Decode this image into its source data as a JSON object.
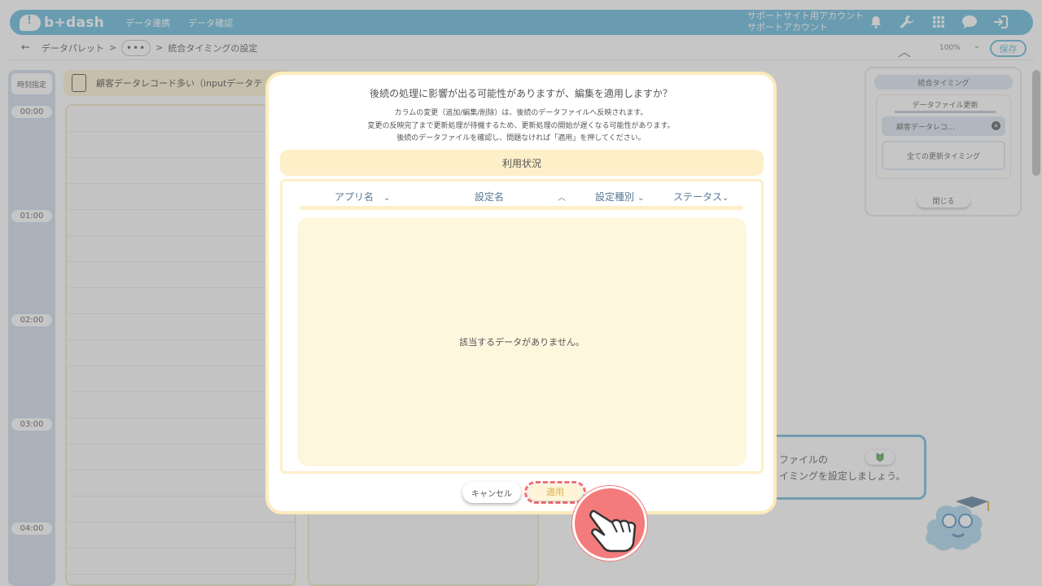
{
  "app": {
    "brand": "b+dash"
  },
  "topnav": {
    "links": [
      "データ連携",
      "データ確認"
    ],
    "account_line1": "サポートサイト用アカウント",
    "account_line2": "サポートアカウント",
    "icons": [
      "bell-icon",
      "wrench-icon",
      "grid-icon",
      "chat-icon",
      "logout-icon"
    ]
  },
  "breadcrumb": {
    "back": "←",
    "item1": "データパレット",
    "sep": ">",
    "more": "•••",
    "current": "統合タイミングの設定"
  },
  "toolbar": {
    "zoom": "100%",
    "save_label": "保存"
  },
  "timeline": {
    "header": "時刻指定",
    "times": [
      "00:00",
      "01:00",
      "02:00",
      "03:00",
      "04:00"
    ]
  },
  "lane": {
    "title": "顧客データレコード多い（inputデータテ"
  },
  "right_panel": {
    "title": "統合タイミング",
    "subtitle": "データファイル更新",
    "chip": "顧客データレコ…",
    "all_timing": "全ての更新タイミング",
    "close": "閉じる"
  },
  "tutorial": {
    "line1": "ファイルの",
    "line2": "イミングを設定しましょう。"
  },
  "dialog": {
    "title": "後続の処理に影響が出る可能性がありますが、編集を適用しますか？",
    "line1": "カラムの変更（追加/編集/削除）は、後続のデータファイルへ反映されます。",
    "line2": "変更の反映完了まで更新処理が待機するため、更新処理の開始が遅くなる可能性があります。",
    "line3": "後続のデータファイルを確認し、問題なければ「適用」を押してください。",
    "section": "利用状況",
    "columns": [
      {
        "label": "アプリ名",
        "icon": "chevron-down-icon"
      },
      {
        "label": "設定名",
        "icon": "chevron-up-icon"
      },
      {
        "label": "設定種別",
        "icon": "chevron-down-icon"
      },
      {
        "label": "ステータス",
        "icon": "chevron-down-icon"
      }
    ],
    "empty": "該当するデータがありません。",
    "cancel": "キャンセル",
    "apply": "適用"
  },
  "colors": {
    "primary": "#5fb7da",
    "cream": "#fdefc8",
    "highlight": "#f4706f"
  }
}
